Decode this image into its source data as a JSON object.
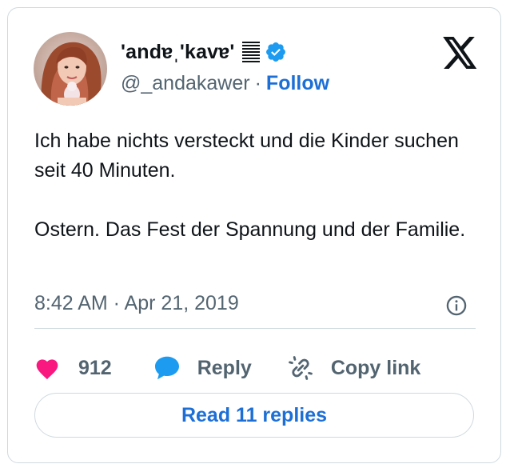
{
  "author": {
    "display_name": "'andɐˌ'kavɐ'",
    "handle": "@_andakawer",
    "separator": "·",
    "follow_label": "Follow",
    "verified": true
  },
  "tweet": {
    "paragraphs": [
      "Ich habe nichts versteckt und die Kinder suchen seit 40 Minuten.",
      "Ostern. Das Fest der Spannung und der Familie."
    ],
    "timestamp": "8:42 AM · Apr 21, 2019"
  },
  "actions": {
    "like_count": "912",
    "reply_label": "Reply",
    "copy_link_label": "Copy link"
  },
  "read_replies_label": "Read 11 replies",
  "icons": {
    "like": "heart-icon",
    "reply": "speech-bubble-icon",
    "copy": "link-icon",
    "info": "info-icon",
    "brand": "x-logo-icon",
    "verified": "verified-badge-icon",
    "flag": "horizontal-lines-icon"
  },
  "colors": {
    "heart": "#f91880",
    "reply_bubble": "#1d9bf0",
    "verified": "#1d9bf0",
    "link_blue": "#1d6fd6",
    "secondary_text": "#536471",
    "border": "#cfd9de"
  }
}
